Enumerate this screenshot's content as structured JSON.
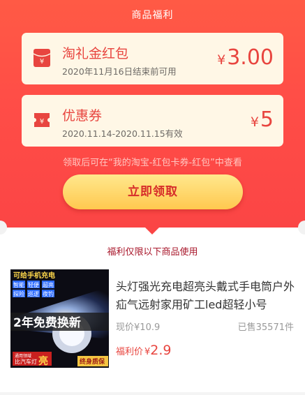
{
  "header": {
    "title": "商品福利"
  },
  "coupons": [
    {
      "icon": "red-envelope-icon",
      "title": "淘礼金红包",
      "subtitle": "2020年11月16日结束前可用",
      "currency": "¥",
      "amount": "3.00"
    },
    {
      "icon": "ticket-icon",
      "title": "优惠券",
      "subtitle": "2020.11.14-2020.11.15有效",
      "currency": "¥",
      "amount": "5"
    }
  ],
  "note": "领取后可在“我的淘宝-红包卡券-红包”中查看",
  "claim_button": "立即领取",
  "section_title": "福利仅限以下商品使用",
  "product": {
    "image_text": {
      "line1": "可给手机充电",
      "tags": [
        "智能",
        "轻便",
        "超亮",
        "探险",
        "巡逻",
        "夜钓"
      ],
      "banner": "2年免费换新",
      "footer_small": "通用领域",
      "footer_compare": "比汽车灯",
      "footer_big": "亮",
      "footer_right": "终身质保"
    },
    "title": "头灯强光充电超亮头戴式手电筒户外疝气远射家用矿工led超轻小号",
    "original_price_label": "现价",
    "original_currency": "¥",
    "original_price": "10.9",
    "sold_label": "已售",
    "sold_count": "35571",
    "sold_unit": "件",
    "deal_label": "福利价",
    "deal_currency": "¥",
    "deal_price": "2.9"
  },
  "colors": {
    "primary_red": "#ff4d47",
    "accent_text": "#e8453f",
    "card_bg": "#fff7e6",
    "button_gold": "#ffc84f"
  }
}
